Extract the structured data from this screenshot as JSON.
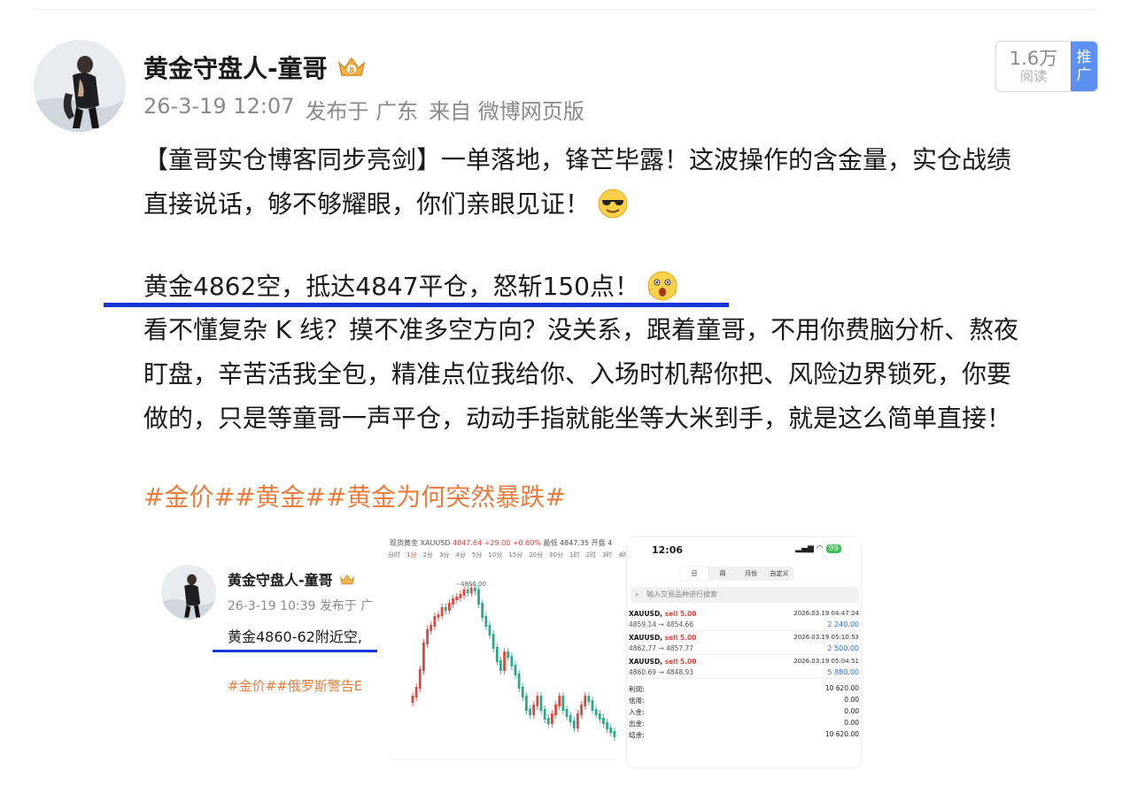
{
  "post": {
    "author": "黄金守盘人-童哥",
    "date": "26-3-19 12:07",
    "published_at": "发布于 广东",
    "source": "来自 微博网页版",
    "reads_count": "1.6万",
    "reads_label": "阅读",
    "promo_label": "推广",
    "paragraph1_line1": "【童哥实仓博客同步亮剑】一单落地，锋芒毕露！这波操作的含金量，实仓战绩",
    "paragraph1_line2": "直接说话，够不够耀眼，你们亲眼见证！",
    "highlight_line": "黄金4862空，抵达4847平仓，怒斩150点！",
    "paragraph2_line1": "看不懂复杂 K 线？摸不准多空方向？没关系，跟着童哥，不用你费脑分析、熬夜",
    "paragraph2_line2": "盯盘，辛苦活我全包，精准点位我给你、入场时机帮你把、风险边界锁死，你要",
    "paragraph2_line3": "做的，只是等童哥一声平仓，动动手指就能坐等大米到手，就是这么简单直接！",
    "hashtags": "#金价##黄金##黄金为何突然暴跌#",
    "emoji1": "sunglasses-emoji",
    "emoji2": "shocked-emoji"
  },
  "embedded_post": {
    "author": "黄金守盘人-童哥",
    "date_place": "26-3-19 10:39  发布于 广",
    "text": "黄金4860-62附近空,",
    "tags": "#金价##俄罗斯警告E"
  },
  "embedded_chart": {
    "symbol": "现货黄金 XAUUSD",
    "price": "4847.64",
    "change": "+29.00",
    "change_pct": "+0.60%",
    "extra": "最低 4847.35 开盘 4",
    "timeframes": [
      "分时",
      "1分",
      "2分",
      "3分",
      "4分",
      "5分",
      "10分",
      "15分",
      "20分",
      "30分",
      "1时",
      "2时",
      "3时",
      "4时"
    ],
    "active_timeframe": "1分",
    "peak_label": "4866.00"
  },
  "phone": {
    "time": "12:06",
    "battery": "99",
    "tabs": [
      "日",
      "周",
      "月份",
      "自定义"
    ],
    "active_tab": "日",
    "search_placeholder": "输入交易品种进行搜索",
    "trades": [
      {
        "symbol": "XAUUSD,",
        "side": "sell 5.00",
        "datetime": "2026.03.19 04:47:24",
        "prices": "4859.14 → 4854.66",
        "profit": "2 240.00"
      },
      {
        "symbol": "XAUUSD,",
        "side": "sell 5.00",
        "datetime": "2026.03.19 05:10:53",
        "prices": "4862.77 → 4857.77",
        "profit": "2 500.00"
      },
      {
        "symbol": "XAUUSD,",
        "side": "sell 5.00",
        "datetime": "2026.03.19 05:04:51",
        "prices": "4860.69 → 4848.93",
        "profit": "5 880.00"
      }
    ],
    "summary": [
      {
        "label": "利润:",
        "value": "10 620.00"
      },
      {
        "label": "信用:",
        "value": "0.00"
      },
      {
        "label": "入金:",
        "value": "0.00"
      },
      {
        "label": "出金:",
        "value": "0.00"
      },
      {
        "label": "结余:",
        "value": "10 620.00"
      }
    ]
  },
  "colors": {
    "hashtag": "#ea7d3d",
    "underline": "#1536d9",
    "promo": "#5b8ff0",
    "candle_up": "#e3443a",
    "candle_down": "#2aa889",
    "profit": "#2a6fe8"
  }
}
